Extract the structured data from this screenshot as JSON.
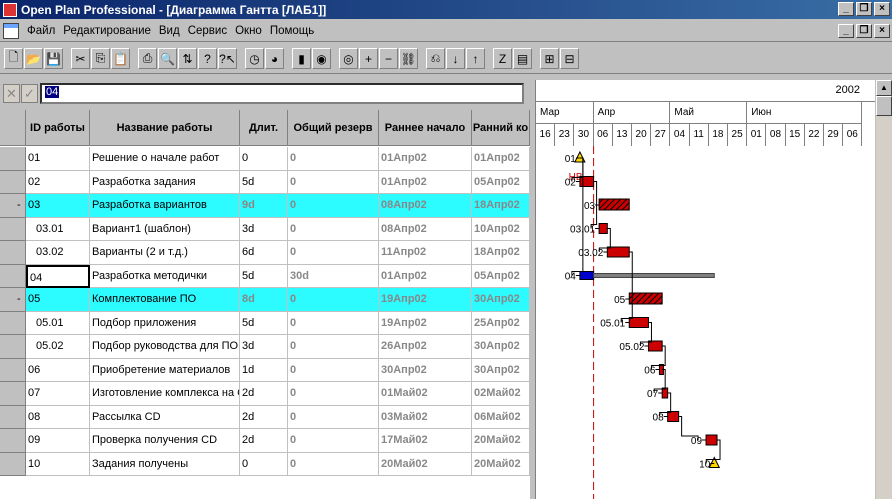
{
  "window": {
    "title": "Open Plan Professional - [Диаграмма Гантта [ЛАБ1]]"
  },
  "menu": [
    "Файл",
    "Редактирование",
    "Вид",
    "Сервис",
    "Окно",
    "Помощь"
  ],
  "edit": {
    "value": "04"
  },
  "columns": [
    "ID работы",
    "Название работы",
    "Длит.",
    "Общий резерв",
    "Раннее начало",
    "Ранний ко"
  ],
  "rows": [
    {
      "id": "01",
      "name": "Решение о начале работ",
      "dur": "0",
      "float": "0",
      "start": "01Апр02",
      "finish": "01Апр02",
      "style": "normal",
      "marker": ""
    },
    {
      "id": "02",
      "name": "Разработка задания",
      "dur": "5d",
      "float": "0",
      "start": "01Апр02",
      "finish": "05Апр02",
      "style": "normal",
      "marker": ""
    },
    {
      "id": "03",
      "name": "Разработка вариантов",
      "dur": "9d",
      "float": "0",
      "start": "08Апр02",
      "finish": "18Апр02",
      "style": "summary",
      "marker": "-"
    },
    {
      "id": "03.01",
      "name": "Вариант1 (шаблон)",
      "dur": "3d",
      "float": "0",
      "start": "08Апр02",
      "finish": "10Апр02",
      "style": "child",
      "marker": ""
    },
    {
      "id": "03.02",
      "name": "Варианты (2 и т.д.)",
      "dur": "6d",
      "float": "0",
      "start": "11Апр02",
      "finish": "18Апр02",
      "style": "child",
      "marker": ""
    },
    {
      "id": "04",
      "name": "Разработка методички",
      "dur": "5d",
      "float": "30d",
      "start": "01Апр02",
      "finish": "05Апр02",
      "style": "selected",
      "marker": ""
    },
    {
      "id": "05",
      "name": "Комплектование ПО",
      "dur": "8d",
      "float": "0",
      "start": "19Апр02",
      "finish": "30Апр02",
      "style": "summary",
      "marker": "-"
    },
    {
      "id": "05.01",
      "name": "Подбор приложения",
      "dur": "5d",
      "float": "0",
      "start": "19Апр02",
      "finish": "25Апр02",
      "style": "child",
      "marker": ""
    },
    {
      "id": "05.02",
      "name": "Подбор руководства для ПО",
      "dur": "3d",
      "float": "0",
      "start": "26Апр02",
      "finish": "30Апр02",
      "style": "child",
      "marker": ""
    },
    {
      "id": "06",
      "name": "Приобретение материалов",
      "dur": "1d",
      "float": "0",
      "start": "30Апр02",
      "finish": "30Апр02",
      "style": "normal",
      "marker": ""
    },
    {
      "id": "07",
      "name": "Изготовление комплекса на CD",
      "dur": "2d",
      "float": "0",
      "start": "01Май02",
      "finish": "02Май02",
      "style": "normal",
      "marker": ""
    },
    {
      "id": "08",
      "name": "Рассылка CD",
      "dur": "2d",
      "float": "0",
      "start": "03Май02",
      "finish": "06Май02",
      "style": "normal",
      "marker": ""
    },
    {
      "id": "09",
      "name": "Проверка получения  CD",
      "dur": "2d",
      "float": "0",
      "start": "17Май02",
      "finish": "20Май02",
      "style": "normal",
      "marker": ""
    },
    {
      "id": "10",
      "name": "Задания получены",
      "dur": "0",
      "float": "0",
      "start": "20Май02",
      "finish": "20Май02",
      "style": "normal",
      "marker": ""
    }
  ],
  "gantt": {
    "year": "2002",
    "months": [
      "Мар",
      "Апр",
      "Май",
      "Июн"
    ],
    "days": [
      "16",
      "23",
      "30",
      "06",
      "13",
      "20",
      "27",
      "04",
      "11",
      "18",
      "25",
      "01",
      "08",
      "15",
      "22",
      "29",
      "06"
    ],
    "data_date_label": "НВ",
    "colors": {
      "critical": "#cc0000",
      "summary_fill": "#cc0000",
      "noncritical": "#0000cc",
      "float": "#808080",
      "milestone": "#ffd700",
      "data_date": "#cc0000"
    },
    "bar_labels": [
      "01",
      "02",
      "03",
      "03.01",
      "03.02",
      "04",
      "05",
      "05.01",
      "05.02",
      "06",
      "07",
      "08",
      "09",
      "10"
    ]
  },
  "toolbar_icons": [
    "new-icon",
    "open-icon",
    "save-icon",
    "cut-icon",
    "copy-icon",
    "paste-icon",
    "print-icon",
    "preview-icon",
    "sort-icon",
    "help-icon",
    "context-help-icon",
    "time-icon",
    "resource-icon",
    "chart-icon",
    "calculate-icon",
    "options-icon",
    "add-icon",
    "remove-icon",
    "link-icon",
    "unlink-icon",
    "down-icon",
    "up-icon",
    "zoom-icon",
    "gantt-view-icon",
    "expand-icon",
    "collapse-icon"
  ]
}
